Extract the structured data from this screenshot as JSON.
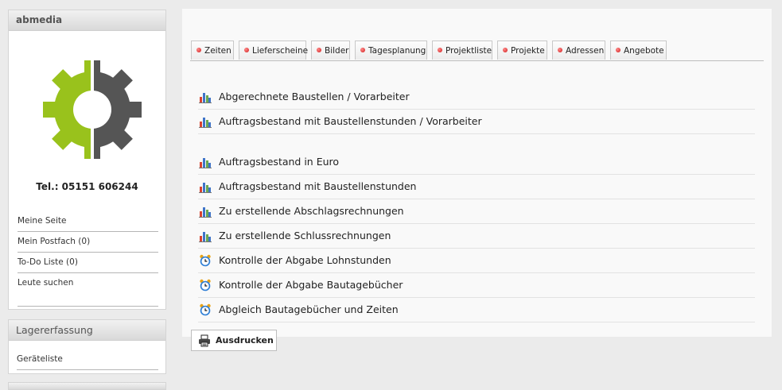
{
  "sidebar": {
    "box1": {
      "title": "abmedia",
      "phone": "Tel.: 05151 606244",
      "items": [
        {
          "label": "Meine Seite"
        },
        {
          "label": "Mein Postfach (0)"
        },
        {
          "label": "To-Do Liste (0)"
        },
        {
          "label": "Leute suchen"
        }
      ]
    },
    "box2": {
      "title": "Lagererfassung",
      "items": [
        {
          "label": "Geräteliste"
        }
      ]
    }
  },
  "tabs": [
    {
      "label": "Zeiten"
    },
    {
      "label": "Lieferscheine"
    },
    {
      "label": "Bilder"
    },
    {
      "label": "Tagesplanung"
    },
    {
      "label": "Projektliste"
    },
    {
      "label": "Projekte"
    },
    {
      "label": "Adressen"
    },
    {
      "label": "Angebote"
    }
  ],
  "reports_group1": [
    {
      "label": "Abgerechnete Baustellen / Vorarbeiter",
      "icon": "bar-chart-icon"
    },
    {
      "label": "Auftragsbestand mit Baustellenstunden / Vorarbeiter",
      "icon": "bar-chart-icon"
    }
  ],
  "reports_group2": [
    {
      "label": "Auftragsbestand in Euro",
      "icon": "bar-chart-icon"
    },
    {
      "label": "Auftragsbestand mit Baustellenstunden",
      "icon": "bar-chart-icon"
    },
    {
      "label": "Zu erstellende Abschlagsrechnungen",
      "icon": "bar-chart-icon"
    },
    {
      "label": "Zu erstellende Schlussrechnungen",
      "icon": "bar-chart-icon"
    },
    {
      "label": "Kontrolle der Abgabe Lohnstunden",
      "icon": "alarm-clock-icon"
    },
    {
      "label": "Kontrolle der Abgabe Bautagebücher",
      "icon": "alarm-clock-icon"
    },
    {
      "label": "Abgleich Bautagebücher und Zeiten",
      "icon": "alarm-clock-icon"
    }
  ],
  "print_button": {
    "label": "Ausdrucken",
    "icon": "printer-icon"
  },
  "colors": {
    "logo_green": "#99c21c",
    "logo_gray": "#555555",
    "tab_dot": "#d11b1b"
  }
}
